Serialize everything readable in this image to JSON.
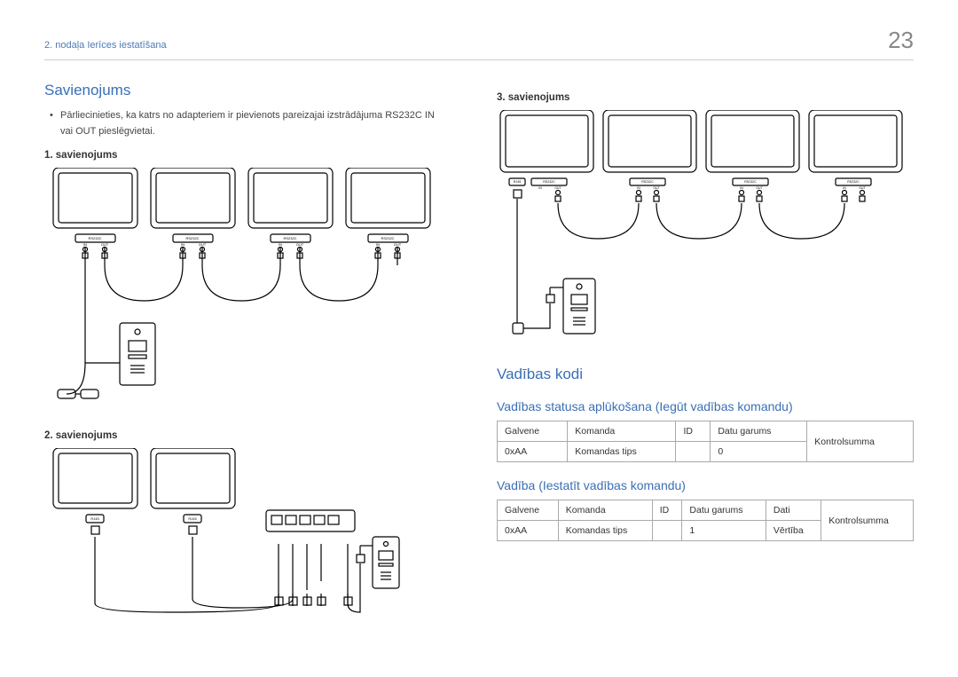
{
  "header": {
    "chapter": "2. nodaļa Ierīces iestatīšana",
    "page": "23"
  },
  "left": {
    "h2": "Savienojums",
    "bullet": "Pārliecinieties, ka katrs no adapteriem ir pievienots pareizajai izstrādājuma RS232C IN vai OUT pieslēgvietai.",
    "conn1": "1. savienojums",
    "conn2": "2. savienojums"
  },
  "right": {
    "conn3": "3. savienojums",
    "h2b": "Vadības kodi",
    "sub1": "Vadības statusa aplūkošana (Iegūt vadības komandu)",
    "sub2": "Vadība (Iestatīt vadības komandu)",
    "table1": {
      "r1": [
        "Galvene",
        "Komanda",
        "ID",
        "Datu garums",
        "Kontrolsumma"
      ],
      "r2": [
        "0xAA",
        "Komandas tips",
        "",
        "0",
        ""
      ]
    },
    "table2": {
      "r1": [
        "Galvene",
        "Komanda",
        "ID",
        "Datu garums",
        "Dati",
        "Kontrolsumma"
      ],
      "r2": [
        "0xAA",
        "Komandas tips",
        "",
        "1",
        "Vērtība",
        ""
      ]
    }
  },
  "port_labels": {
    "rs232c": "RS232C",
    "in": "IN",
    "out": "OUT",
    "rj45": "RJ45"
  }
}
